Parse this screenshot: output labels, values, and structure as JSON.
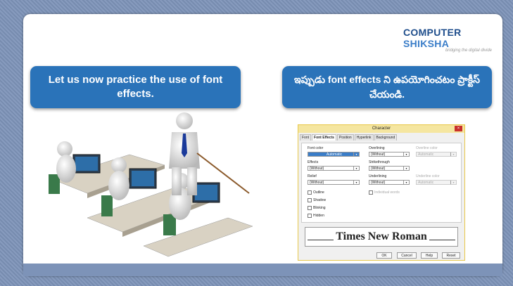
{
  "logo": {
    "part1": "COMPUTER",
    "part2": "SHIKSHA",
    "tagline": "bridging the digital divide"
  },
  "callouts": {
    "english": "Let us now practice the use of font effects.",
    "telugu": "ఇప్పుడు font effects ని ఉపయోగించటం ప్రాక్టీస్ చేయండి."
  },
  "dialog": {
    "title": "Character",
    "close": "×",
    "tabs": [
      "Font",
      "Font Effects",
      "Position",
      "Hyperlink",
      "Background"
    ],
    "font_color": {
      "label": "Font color",
      "value": "Automatic"
    },
    "effects": {
      "label": "Effects",
      "value": "(Without)"
    },
    "relief": {
      "label": "Relief",
      "value": "(Without)"
    },
    "checks": [
      "Outline",
      "Shadow",
      "Blinking",
      "Hidden"
    ],
    "overlining": {
      "label": "Overlining",
      "value": "(Without)"
    },
    "strikethrough": {
      "label": "Strikethrough",
      "value": "(Without)"
    },
    "underlining": {
      "label": "Underlining",
      "value": "(Without)"
    },
    "individual_words": "Individual words",
    "overline_color": {
      "label": "Overline color",
      "value": "Automatic"
    },
    "underline_color": {
      "label": "Underline color",
      "value": "Automatic"
    },
    "preview": "Times New Roman",
    "buttons": {
      "ok": "OK",
      "cancel": "Cancel",
      "help": "Help",
      "reset": "Reset"
    }
  }
}
